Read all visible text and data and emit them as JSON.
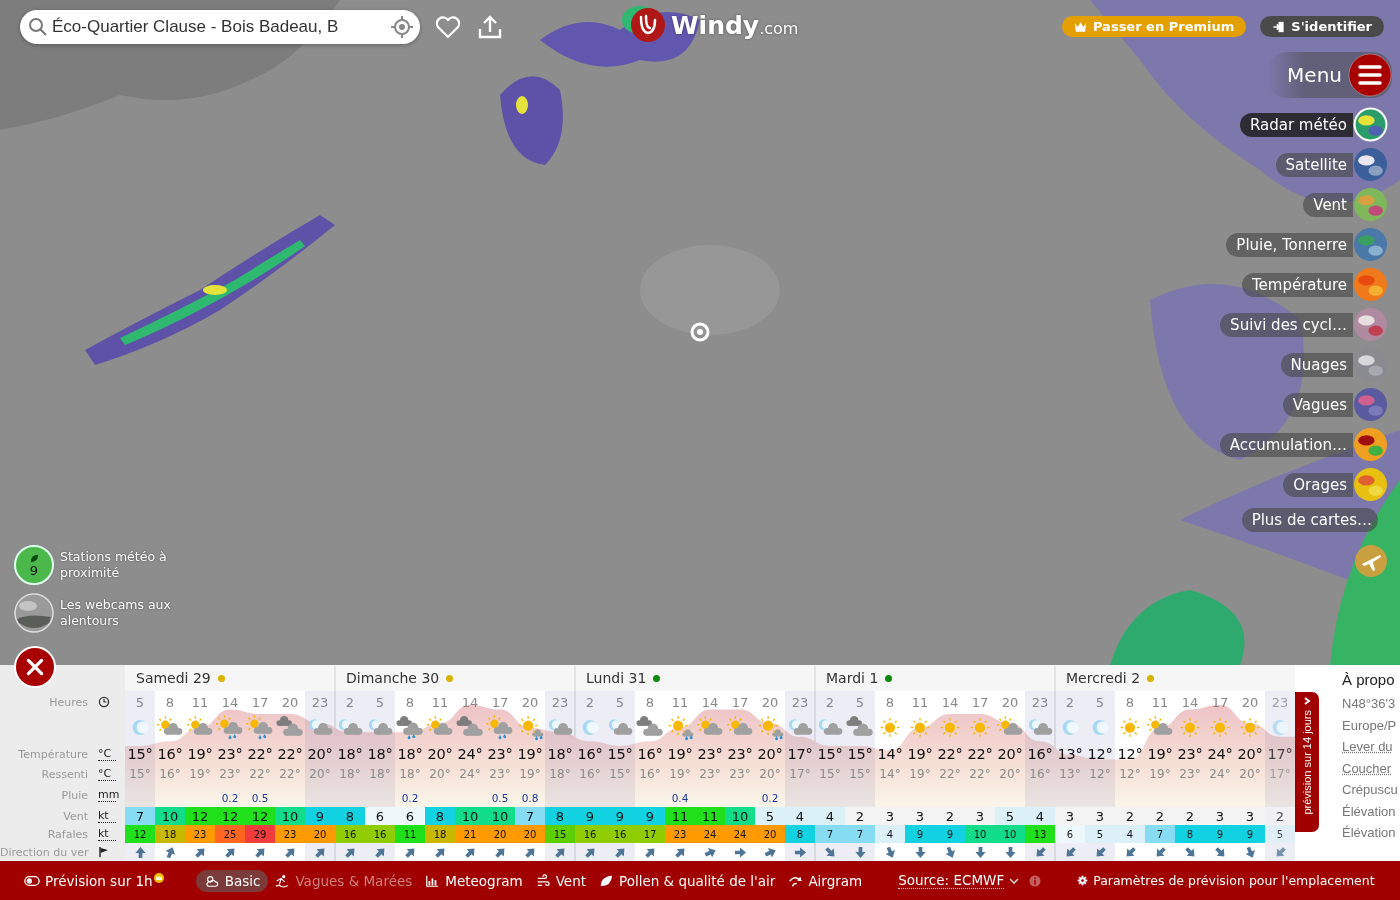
{
  "search": {
    "value": "Éco-Quartier Clause - Bois Badeau, B"
  },
  "logo": {
    "name": "Windy",
    "suffix": ".com"
  },
  "account": [
    {
      "label": "Passer en Premium",
      "kind": "premium"
    },
    {
      "label": "S'identifier",
      "kind": "login"
    }
  ],
  "menu": {
    "label": "Menu"
  },
  "layers": [
    {
      "label": "Radar météo",
      "kind": "radar",
      "selected": true
    },
    {
      "label": "Satellite",
      "kind": "satellite",
      "selected": false
    },
    {
      "label": "Vent",
      "kind": "wind",
      "selected": false
    },
    {
      "label": "Pluie, Tonnerre",
      "kind": "rain",
      "selected": false
    },
    {
      "label": "Température",
      "kind": "temperature",
      "selected": false
    },
    {
      "label": "Suivi des cycl…",
      "kind": "cyclones",
      "selected": false
    },
    {
      "label": "Nuages",
      "kind": "clouds",
      "selected": false
    },
    {
      "label": "Vagues",
      "kind": "waves",
      "selected": false
    },
    {
      "label": "Accumulation…",
      "kind": "accumulation",
      "selected": false
    },
    {
      "label": "Orages",
      "kind": "storms",
      "selected": false
    },
    {
      "label": "Plus de cartes…",
      "kind": "more",
      "selected": false
    }
  ],
  "nearby": [
    {
      "kind": "stations",
      "label": "Stations météo à proximité",
      "count": "9"
    },
    {
      "kind": "webcams",
      "label": "Les webcams aux alentours"
    }
  ],
  "forecast": {
    "row_labels": [
      {
        "label": "Heures",
        "kind": "clock"
      },
      {
        "label": "Température",
        "kind": "unit",
        "unit": "°C"
      },
      {
        "label": "Ressenti",
        "kind": "unit",
        "unit": "°C"
      },
      {
        "label": "Pluie",
        "kind": "unit",
        "unit": "mm"
      },
      {
        "label": "Vent",
        "kind": "unit",
        "unit": "kt"
      },
      {
        "label": "Rafales",
        "kind": "unit",
        "unit": "kt"
      },
      {
        "label": "Direction du ver",
        "kind": "flag"
      }
    ],
    "days": [
      {
        "label": "Samedi 29",
        "color": "#d9b300",
        "hours": [
          {
            "hour": "5",
            "night": true,
            "faded": false,
            "sky": {
              "kind": "moon"
            },
            "temp": "15°",
            "feels": "15°",
            "wind": "7",
            "gust": "12",
            "wind_arrow": {
              "kind": "N"
            }
          },
          {
            "hour": "8",
            "night": false,
            "faded": false,
            "sky": {
              "kind": "sun-cloud"
            },
            "temp": "16°",
            "feels": "16°",
            "wind": "10",
            "gust": "18",
            "wind_arrow": {
              "kind": "NNE"
            }
          },
          {
            "hour": "11",
            "night": false,
            "faded": false,
            "sky": {
              "kind": "sun-cloud"
            },
            "temp": "19°",
            "feels": "19°",
            "wind": "12",
            "gust": "23",
            "wind_arrow": {
              "kind": "NE"
            }
          },
          {
            "hour": "14",
            "night": false,
            "faded": false,
            "sky": {
              "kind": "sun-cloud-rain"
            },
            "temp": "23°",
            "feels": "23°",
            "rain": "0.2",
            "wind": "12",
            "gust": "25",
            "wind_arrow": {
              "kind": "NE"
            }
          },
          {
            "hour": "17",
            "night": false,
            "faded": false,
            "sky": {
              "kind": "sun-cloud-rain"
            },
            "temp": "22°",
            "feels": "22°",
            "rain": "0.5",
            "wind": "12",
            "gust": "29",
            "wind_arrow": {
              "kind": "NE"
            }
          },
          {
            "hour": "20",
            "night": false,
            "faded": false,
            "sky": {
              "kind": "cloud"
            },
            "temp": "22°",
            "feels": "22°",
            "wind": "10",
            "gust": "23",
            "wind_arrow": {
              "kind": "NE"
            }
          },
          {
            "hour": "23",
            "night": true,
            "faded": false,
            "sky": {
              "kind": "moon-cloud"
            },
            "temp": "20°",
            "feels": "20°",
            "wind": "9",
            "gust": "20",
            "wind_arrow": {
              "kind": "NE"
            }
          }
        ]
      },
      {
        "label": "Dimanche 30",
        "color": "#d9b300",
        "hours": [
          {
            "hour": "2",
            "night": true,
            "faded": false,
            "sky": {
              "kind": "moon-cloud"
            },
            "temp": "18°",
            "feels": "18°",
            "wind": "8",
            "gust": "16",
            "wind_arrow": {
              "kind": "NE"
            }
          },
          {
            "hour": "5",
            "night": true,
            "faded": false,
            "sky": {
              "kind": "moon-cloud"
            },
            "temp": "18°",
            "feels": "18°",
            "wind": "6",
            "gust": "16",
            "wind_arrow": {
              "kind": "NE"
            }
          },
          {
            "hour": "8",
            "night": false,
            "faded": false,
            "sky": {
              "kind": "cloud-rain"
            },
            "temp": "18°",
            "feels": "18°",
            "rain": "0.2",
            "wind": "6",
            "gust": "11",
            "wind_arrow": {
              "kind": "NE"
            }
          },
          {
            "hour": "11",
            "night": false,
            "faded": false,
            "sky": {
              "kind": "sun-cloud"
            },
            "temp": "20°",
            "feels": "20°",
            "wind": "8",
            "gust": "18",
            "wind_arrow": {
              "kind": "NE"
            }
          },
          {
            "hour": "14",
            "night": false,
            "faded": false,
            "sky": {
              "kind": "cloud"
            },
            "temp": "24°",
            "feels": "24°",
            "wind": "10",
            "gust": "21",
            "wind_arrow": {
              "kind": "NE"
            }
          },
          {
            "hour": "17",
            "night": false,
            "faded": false,
            "sky": {
              "kind": "sun-cloud-rain"
            },
            "temp": "23°",
            "feels": "23°",
            "rain": "0.5",
            "wind": "10",
            "gust": "20",
            "wind_arrow": {
              "kind": "NE"
            }
          },
          {
            "hour": "20",
            "night": false,
            "faded": false,
            "sky": {
              "kind": "sun-rain"
            },
            "temp": "19°",
            "feels": "19°",
            "rain": "0.8",
            "wind": "7",
            "gust": "20",
            "wind_arrow": {
              "kind": "NE"
            }
          },
          {
            "hour": "23",
            "night": true,
            "faded": false,
            "sky": {
              "kind": "moon-cloud"
            },
            "temp": "18°",
            "feels": "18°",
            "wind": "8",
            "gust": "15",
            "wind_arrow": {
              "kind": "NE"
            }
          }
        ]
      },
      {
        "label": "Lundi 31",
        "color": "#0a8a0a",
        "hours": [
          {
            "hour": "2",
            "night": true,
            "faded": false,
            "sky": {
              "kind": "moon"
            },
            "temp": "16°",
            "feels": "16°",
            "wind": "9",
            "gust": "16",
            "wind_arrow": {
              "kind": "NE"
            }
          },
          {
            "hour": "5",
            "night": true,
            "faded": false,
            "sky": {
              "kind": "moon-cloud"
            },
            "temp": "15°",
            "feels": "15°",
            "wind": "9",
            "gust": "16",
            "wind_arrow": {
              "kind": "NE"
            }
          },
          {
            "hour": "8",
            "night": false,
            "faded": false,
            "sky": {
              "kind": "cloud"
            },
            "temp": "16°",
            "feels": "16°",
            "wind": "9",
            "gust": "17",
            "wind_arrow": {
              "kind": "NE"
            }
          },
          {
            "hour": "11",
            "night": false,
            "faded": false,
            "sky": {
              "kind": "sun-rain"
            },
            "temp": "19°",
            "feels": "19°",
            "rain": "0.4",
            "wind": "11",
            "gust": "23",
            "wind_arrow": {
              "kind": "NE"
            }
          },
          {
            "hour": "14",
            "night": false,
            "faded": false,
            "sky": {
              "kind": "sun-cloud"
            },
            "temp": "23°",
            "feels": "23°",
            "wind": "11",
            "gust": "24",
            "wind_arrow": {
              "kind": "ENE"
            }
          },
          {
            "hour": "17",
            "night": false,
            "faded": false,
            "sky": {
              "kind": "sun-cloud"
            },
            "temp": "23°",
            "feels": "23°",
            "wind": "10",
            "gust": "24",
            "wind_arrow": {
              "kind": "E"
            }
          },
          {
            "hour": "20",
            "night": false,
            "faded": false,
            "sky": {
              "kind": "sun-rain"
            },
            "temp": "20°",
            "feels": "20°",
            "rain": "0.2",
            "wind": "5",
            "gust": "20",
            "wind_arrow": {
              "kind": "ENE"
            }
          },
          {
            "hour": "23",
            "night": true,
            "faded": false,
            "sky": {
              "kind": "moon-cloud"
            },
            "temp": "17°",
            "feels": "17°",
            "wind": "4",
            "gust": "8",
            "wind_arrow": {
              "kind": "E"
            }
          }
        ]
      },
      {
        "label": "Mardi 1",
        "color": "#0a8a0a",
        "hours": [
          {
            "hour": "2",
            "night": true,
            "faded": false,
            "sky": {
              "kind": "moon-cloud"
            },
            "temp": "15°",
            "feels": "15°",
            "wind": "4",
            "gust": "7",
            "wind_arrow": {
              "kind": "SE"
            }
          },
          {
            "hour": "5",
            "night": true,
            "faded": false,
            "sky": {
              "kind": "cloud"
            },
            "temp": "15°",
            "feels": "15°",
            "wind": "2",
            "gust": "7",
            "wind_arrow": {
              "kind": "S"
            }
          },
          {
            "hour": "8",
            "night": false,
            "faded": false,
            "sky": {
              "kind": "sun"
            },
            "temp": "14°",
            "feels": "14°",
            "wind": "3",
            "gust": "4",
            "wind_arrow": {
              "kind": "SSE"
            }
          },
          {
            "hour": "11",
            "night": false,
            "faded": false,
            "sky": {
              "kind": "sun"
            },
            "temp": "19°",
            "feels": "19°",
            "wind": "3",
            "gust": "9",
            "wind_arrow": {
              "kind": "S"
            }
          },
          {
            "hour": "14",
            "night": false,
            "faded": false,
            "sky": {
              "kind": "sun"
            },
            "temp": "22°",
            "feels": "22°",
            "wind": "2",
            "gust": "9",
            "wind_arrow": {
              "kind": "SSE"
            }
          },
          {
            "hour": "17",
            "night": false,
            "faded": false,
            "sky": {
              "kind": "sun"
            },
            "temp": "22°",
            "feels": "22°",
            "wind": "3",
            "gust": "10",
            "wind_arrow": {
              "kind": "S"
            }
          },
          {
            "hour": "20",
            "night": false,
            "faded": false,
            "sky": {
              "kind": "sun-cloud"
            },
            "temp": "20°",
            "feels": "20°",
            "wind": "5",
            "gust": "10",
            "wind_arrow": {
              "kind": "S"
            }
          },
          {
            "hour": "23",
            "night": true,
            "faded": false,
            "sky": {
              "kind": "moon-cloud"
            },
            "temp": "16°",
            "feels": "16°",
            "wind": "4",
            "gust": "13",
            "wind_arrow": {
              "kind": "SW"
            }
          }
        ]
      },
      {
        "label": "Mercredi 2",
        "color": "#d9b300",
        "hours": [
          {
            "hour": "2",
            "night": true,
            "faded": false,
            "sky": {
              "kind": "moon"
            },
            "temp": "13°",
            "feels": "13°",
            "wind": "3",
            "gust": "6",
            "wind_arrow": {
              "kind": "SW"
            }
          },
          {
            "hour": "5",
            "night": true,
            "faded": false,
            "sky": {
              "kind": "moon"
            },
            "temp": "12°",
            "feels": "12°",
            "wind": "3",
            "gust": "5",
            "wind_arrow": {
              "kind": "SW"
            }
          },
          {
            "hour": "8",
            "night": false,
            "faded": false,
            "sky": {
              "kind": "sun"
            },
            "temp": "12°",
            "feels": "12°",
            "wind": "2",
            "gust": "4",
            "wind_arrow": {
              "kind": "SW"
            }
          },
          {
            "hour": "11",
            "night": false,
            "faded": false,
            "sky": {
              "kind": "sun-cloud"
            },
            "temp": "19°",
            "feels": "19°",
            "wind": "2",
            "gust": "7",
            "wind_arrow": {
              "kind": "SW"
            }
          },
          {
            "hour": "14",
            "night": false,
            "faded": false,
            "sky": {
              "kind": "sun"
            },
            "temp": "23°",
            "feels": "23°",
            "wind": "2",
            "gust": "8",
            "wind_arrow": {
              "kind": "SE"
            }
          },
          {
            "hour": "17",
            "night": false,
            "faded": false,
            "sky": {
              "kind": "sun"
            },
            "temp": "24°",
            "feels": "24°",
            "wind": "3",
            "gust": "9",
            "wind_arrow": {
              "kind": "SE"
            }
          },
          {
            "hour": "20",
            "night": false,
            "faded": false,
            "sky": {
              "kind": "sun"
            },
            "temp": "20°",
            "feels": "20°",
            "wind": "3",
            "gust": "9",
            "wind_arrow": {
              "kind": "SSE"
            }
          },
          {
            "hour": "23",
            "night": true,
            "faded": true,
            "sky": {
              "kind": "moon"
            },
            "temp": "17°",
            "feels": "17°",
            "wind": "2",
            "gust": "5",
            "wind_arrow": {
              "kind": "SW"
            }
          }
        ]
      }
    ]
  },
  "long_forecast": {
    "label": "prévision sur 14 jours"
  },
  "info": [
    {
      "text": "À propo",
      "kind": "title"
    },
    {
      "text": "N48°36'3",
      "kind": "plain"
    },
    {
      "text": "Europe/P",
      "kind": "plain"
    },
    {
      "text": "Lever du",
      "kind": "link"
    },
    {
      "text": "Coucher",
      "kind": "link"
    },
    {
      "text": "Crépuscu",
      "kind": "plain"
    },
    {
      "text": "Élévation",
      "kind": "plain"
    },
    {
      "text": "Élévation",
      "kind": "plain"
    }
  ],
  "bottom_bar": {
    "hourly": {
      "label": "Prévision sur 1h"
    },
    "views": [
      {
        "label": "Basic",
        "kind": "basic",
        "selected": true,
        "disabled": false
      },
      {
        "label": "Vagues & Marées",
        "kind": "waves",
        "selected": false,
        "disabled": true
      },
      {
        "label": "Meteogram",
        "kind": "meteogram",
        "selected": false,
        "disabled": false
      },
      {
        "label": "Vent",
        "kind": "wind",
        "selected": false,
        "disabled": false
      },
      {
        "label": "Pollen & qualité de l'air",
        "kind": "pollen",
        "selected": false,
        "disabled": false
      },
      {
        "label": "Airgram",
        "kind": "airgram",
        "selected": false,
        "disabled": false
      }
    ],
    "source": "Source: ECMWF",
    "settings": "Paramètres de prévision pour l'emplacement"
  }
}
